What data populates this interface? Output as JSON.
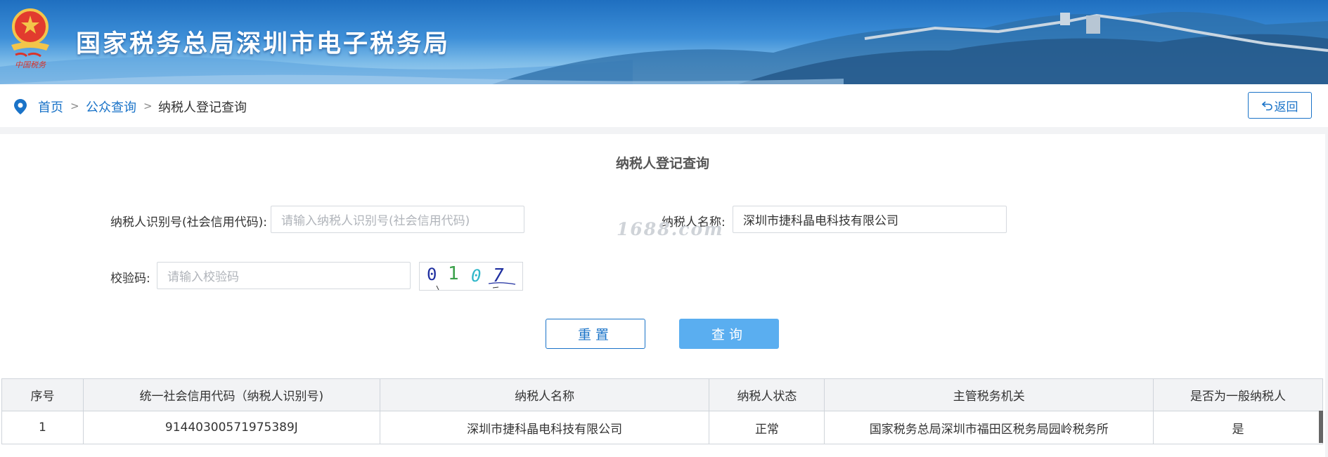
{
  "header": {
    "site_title": "国家税务总局深圳市电子税务局",
    "emblem_caption": "中国税务"
  },
  "breadcrumb": {
    "home": "首页",
    "public_query": "公众查询",
    "current": "纳税人登记查询",
    "separator": ">"
  },
  "back_button": {
    "label": "返回",
    "icon": "undo-icon"
  },
  "form": {
    "title": "纳税人登记查询",
    "taxpayer_id_label": "纳税人识别号(社会信用代码):",
    "taxpayer_id_placeholder": "请输入纳税人识别号(社会信用代码)",
    "taxpayer_id_value": "",
    "taxpayer_name_label": "纳税人名称:",
    "taxpayer_name_value": "深圳市捷科晶电科技有限公司",
    "captcha_label": "校验码:",
    "captcha_placeholder": "请输入校验码",
    "captcha_text": [
      "0",
      "1",
      "0",
      "7"
    ],
    "reset_label": "重置",
    "query_label": "查询"
  },
  "watermark": "1688.com",
  "table": {
    "headers": [
      "序号",
      "统一社会信用代码（纳税人识别号)",
      "纳税人名称",
      "纳税人状态",
      "主管税务机关",
      "是否为一般纳税人"
    ],
    "rows": [
      [
        "1",
        "91440300571975389J",
        "深圳市捷科晶电科技有限公司",
        "正常",
        "国家税务总局深圳市福田区税务局园岭税务所",
        "是"
      ]
    ]
  },
  "colors": {
    "primary": "#1a73c8",
    "query_button": "#5aaef0",
    "header_sky": "#3d8fd8"
  }
}
